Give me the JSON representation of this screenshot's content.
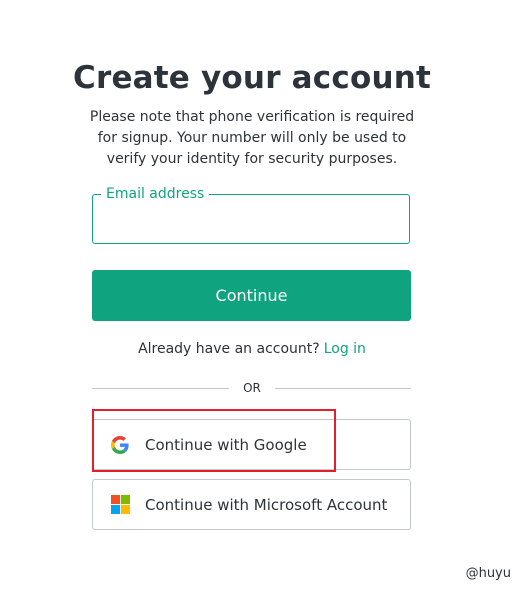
{
  "header": {
    "title": "Create your account",
    "subtitle": "Please note that phone verification is required for signup. Your number will only be used to verify your identity for security purposes."
  },
  "email": {
    "label": "Email address",
    "value": "",
    "placeholder": ""
  },
  "continue_button": {
    "label": "Continue",
    "color": "#10a37f"
  },
  "login_prompt": {
    "text": "Already have an account?",
    "link_label": "Log in"
  },
  "divider": {
    "label": "OR"
  },
  "social": {
    "google": {
      "label": "Continue with Google",
      "icon": "google-icon"
    },
    "microsoft": {
      "label": "Continue with Microsoft Account",
      "icon": "microsoft-icon"
    }
  },
  "annotation": {
    "highlight_color": "#e0202a"
  },
  "watermark": "@huyu"
}
